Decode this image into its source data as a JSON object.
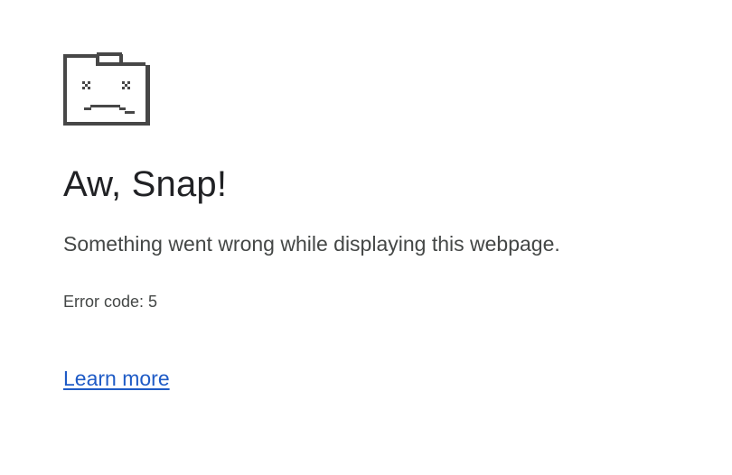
{
  "error_page": {
    "icon": "sad-folder-icon",
    "title": "Aw, Snap!",
    "message": "Something went wrong while displaying this webpage.",
    "error_code": "Error code: 5",
    "learn_more": "Learn more"
  },
  "colors": {
    "background": "#ffffff",
    "title_text": "#202124",
    "body_text": "#444746",
    "icon": "#474747",
    "link": "#1f5bc6"
  }
}
